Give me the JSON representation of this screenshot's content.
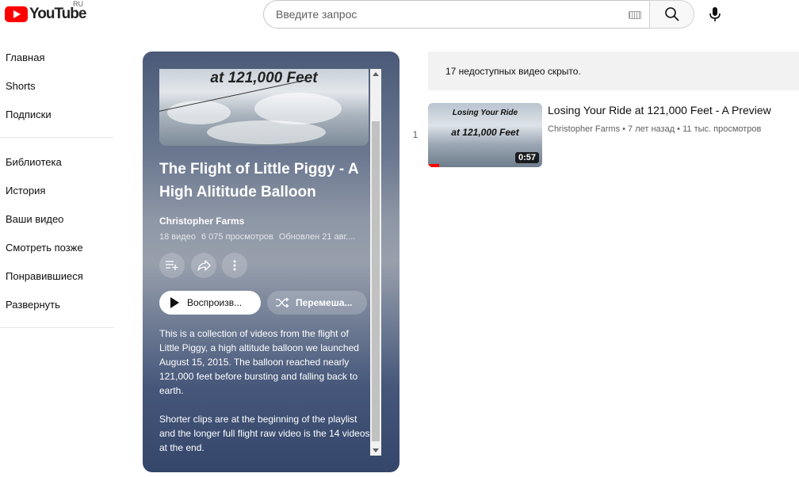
{
  "header": {
    "logo_text": "YouTube",
    "region": "RU",
    "search_placeholder": "Введите запрос"
  },
  "sidebar": {
    "group1": [
      "Главная",
      "Shorts",
      "Подписки"
    ],
    "group2": [
      "Библиотека",
      "История",
      "Ваши видео",
      "Смотреть позже",
      "Понравившиеся",
      "Развернуть"
    ]
  },
  "playlist": {
    "thumb_caption": "at 121,000 Feet",
    "title": "The Flight of Little Piggy - A High Alititude Balloon",
    "owner": "Christopher Farms",
    "video_count": "18 видео",
    "views": "6 075 просмотров",
    "updated": "Обновлен 21 авг....",
    "play_label": "Воспроизв...",
    "shuffle_label": "Перемеша...",
    "description_p1": "This is a collection of videos from the flight of Little Piggy, a high altitude balloon we launched August 15, 2015. The balloon reached nearly 121,000 feet before bursting and falling back to earth.",
    "description_p2": "Shorter clips are at the beginning of the playlist and the longer full flight raw video is the 14 videos at the end."
  },
  "hidden_notice": "17 недоступных видео скрыто.",
  "videos": [
    {
      "index": "1",
      "thumb_line1": "Losing Your Ride",
      "thumb_line2": "at 121,000 Feet",
      "title": "Losing Your Ride at 121,000 Feet - A Preview",
      "meta": "Christopher Farms • 7 лет назад • 11 тыс. просмотров",
      "duration": "0:57",
      "watched_fraction": 0.1
    }
  ],
  "colors": {
    "brand_red": "#ff0000",
    "panel_dark": "#34466a"
  }
}
